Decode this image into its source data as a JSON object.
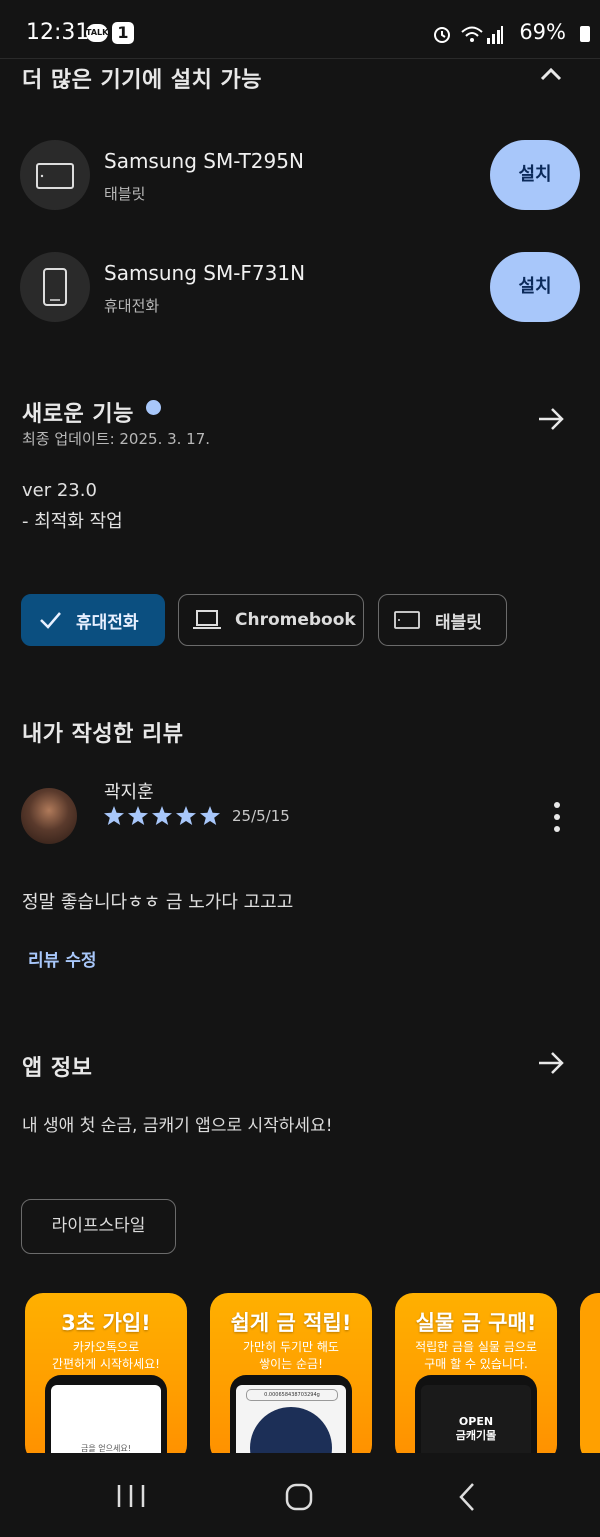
{
  "status_bar": {
    "time": "12:31",
    "talk_label": "TALK",
    "notif_count": "1",
    "battery": "69%"
  },
  "install_section": {
    "title": "더 많은 기기에 설치 가능",
    "devices": [
      {
        "name": "Samsung SM-T295N",
        "type": "태블릿",
        "button": "설치"
      },
      {
        "name": "Samsung SM-F731N",
        "type": "휴대전화",
        "button": "설치"
      }
    ]
  },
  "whats_new": {
    "title": "새로운 기능",
    "updated": "최종 업데이트: 2025. 3. 17.",
    "version": "ver 23.0",
    "note": "- 최적화 작업"
  },
  "device_chips": [
    {
      "label": "휴대전화",
      "selected": true
    },
    {
      "label": "Chromebook",
      "selected": false
    },
    {
      "label": "태블릿",
      "selected": false
    }
  ],
  "my_review": {
    "title": "내가 작성한 리뷰",
    "author": "곽지훈",
    "rating": 5,
    "date": "25/5/15",
    "text": "정말 좋습니다ㅎㅎ 금 노가다 고고고",
    "edit_label": "리뷰 수정"
  },
  "app_info": {
    "title": "앱 정보",
    "description": "내 생애 첫 순금, 금캐기 앱으로 시작하세요!",
    "category": "라이프스타일"
  },
  "screenshots": [
    {
      "title": "3초 가입!",
      "line1": "카카오톡으로",
      "line2": "간편하게 시작하세요!",
      "screen_text": "금을 얻으세요!"
    },
    {
      "title": "쉽게 금 적립!",
      "line1": "가만히 두기만 해도",
      "line2": "쌓이는 순금!",
      "screen_text": "0.000658438703294g"
    },
    {
      "title": "실물 금 구매!",
      "line1": "적립한 금을 실물 금으로",
      "line2": "구매 할 수 있습니다.",
      "screen_text": "OPEN\n금캐기몰"
    }
  ],
  "colors": {
    "accent": "#a8c7fa",
    "selected_chip": "#0b4f80",
    "card_orange": "#ffa000",
    "dot": "#a8c7fa"
  }
}
